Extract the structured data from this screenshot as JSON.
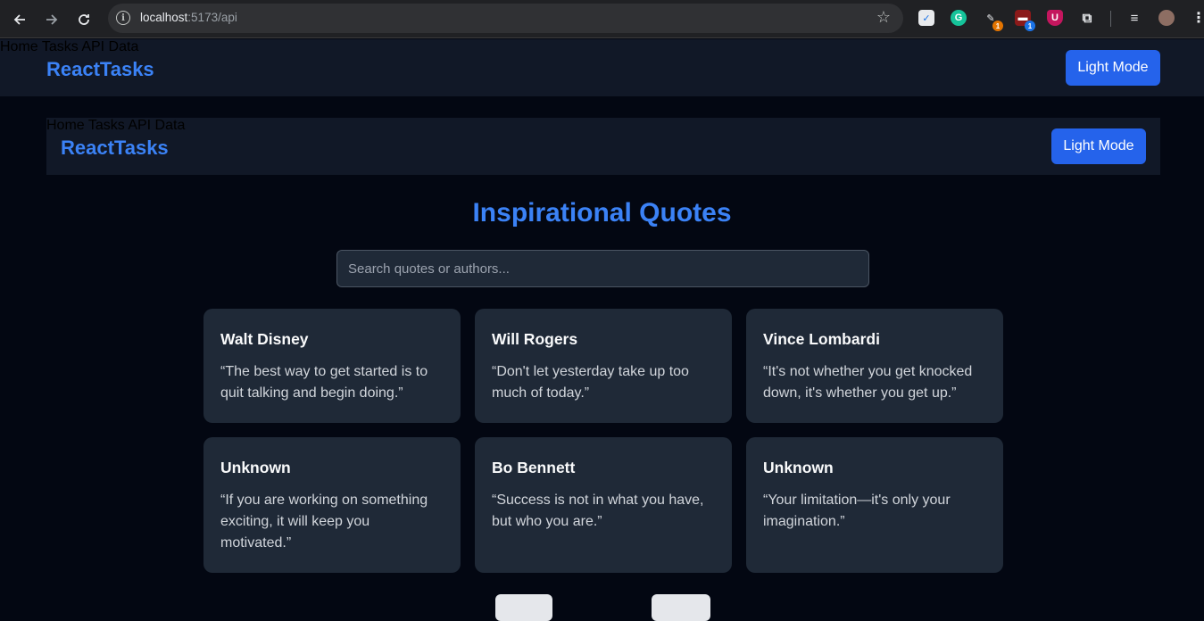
{
  "browser": {
    "url_host": "localhost",
    "url_path": ":5173/api",
    "extensions": [
      {
        "name": "calendar-extension-icon",
        "color": "#e8eaed"
      },
      {
        "name": "grammarly-extension-icon",
        "color": "#15c39a"
      },
      {
        "name": "extension-badge-1",
        "badge": "1"
      },
      {
        "name": "extension-badge-2",
        "badge": "1"
      },
      {
        "name": "ublock-extension-icon",
        "color": "#c4165e"
      }
    ]
  },
  "outer_header": {
    "brand": "ReactTasks",
    "nav": [
      "Home",
      "Tasks",
      "API Data"
    ],
    "mode_button": "Light Mode"
  },
  "inner_header": {
    "brand": "ReactTasks",
    "nav": [
      "Home",
      "Tasks",
      "API Data"
    ],
    "mode_button": "Light Mode"
  },
  "main": {
    "title": "Inspirational Quotes",
    "search_placeholder": "Search quotes or authors...",
    "quotes": [
      {
        "author": "Walt Disney",
        "text": "“The best way to get started is to quit talking and begin doing.”"
      },
      {
        "author": "Will Rogers",
        "text": "“Don't let yesterday take up too much of today.”"
      },
      {
        "author": "Vince Lombardi",
        "text": "“It's not whether you get knocked down, it's whether you get up.”"
      },
      {
        "author": "Unknown",
        "text": "“If you are working on something exciting, it will keep you motivated.”"
      },
      {
        "author": "Bo Bennett",
        "text": "“Success is not in what you have, but who you are.”"
      },
      {
        "author": "Unknown",
        "text": "“Your limitation—it's only your imagination.”"
      }
    ]
  },
  "colors": {
    "background": "#030712",
    "header": "#111827",
    "card": "#1f2937",
    "accent": "#3b82f6",
    "button": "#2563eb"
  }
}
